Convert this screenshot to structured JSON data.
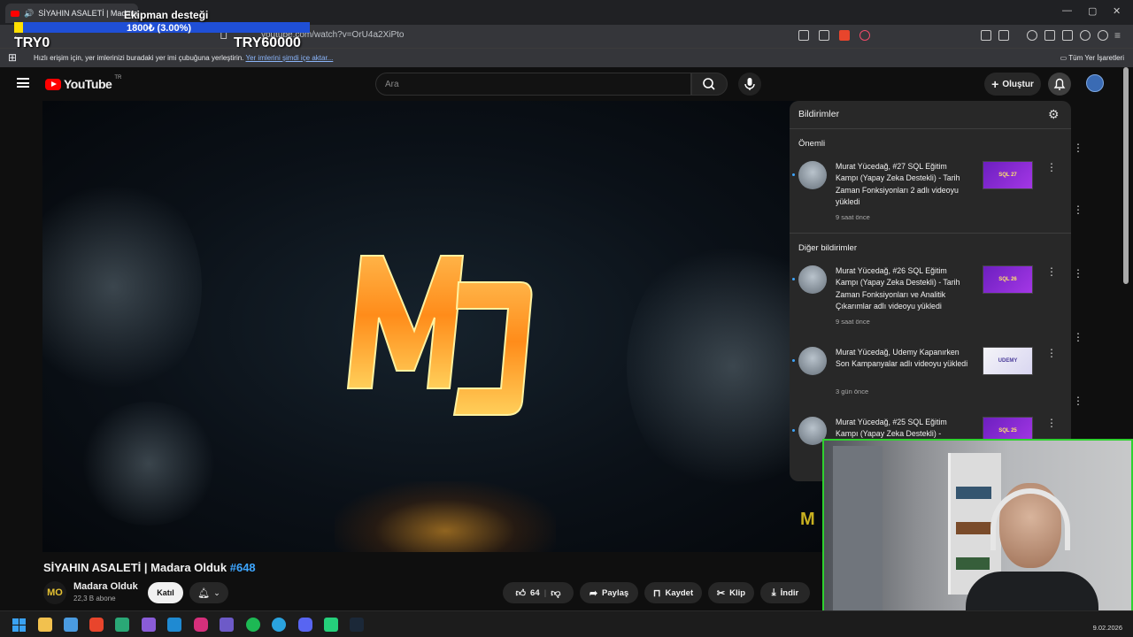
{
  "browser": {
    "tab_title": "SİYAHIN ASALETİ | Madara O",
    "url": "youtube.com/watch?v=OrU4a2XiPto",
    "bookmarks_hint": "Hızlı erişim için, yer imlerinizi buradaki yer imi çubuğuna yerleştirin.",
    "bookmarks_link": "Yer imlerini şimdi içe aktar...",
    "all_bookmarks": "Tüm Yer İşaretleri"
  },
  "overlay": {
    "title": "Ekipman desteği",
    "amount": "1800₺ (3.00%)",
    "progress": 0.03,
    "left_label": "TRY0",
    "right_label": "TRY60000"
  },
  "youtube": {
    "logo_text": "YouTube",
    "region": "TR",
    "search_placeholder": "Ara",
    "create_label": "Oluştur"
  },
  "video": {
    "title": "SİYAHIN ASALETİ | Madara Olduk",
    "tag": "#648",
    "channel": "Madara Olduk",
    "channel_initials": "MO",
    "subscribers": "22,3 B abone",
    "join_label": "Katıl",
    "likes": "64",
    "share_label": "Paylaş",
    "save_label": "Kaydet",
    "clip_label": "Klip",
    "download_label": "İndir"
  },
  "notifications": {
    "title": "Bildirimler",
    "important_label": "Önemli",
    "other_label": "Diğer bildirimler",
    "items": [
      {
        "text": "Murat Yücedağ, #27 SQL Eğitim Kampı (Yapay Zeka Destekli) - Tarih Zaman Fonksiyonları 2 adlı videoyu yükledi",
        "time": "9 saat önce",
        "thumb": "SQL 27"
      },
      {
        "text": "Murat Yücedağ, #26 SQL Eğitim Kampı (Yapay Zeka Destekli) - Tarih Zaman Fonksiyonları ve Analitik Çıkarımlar adlı videoyu yükledi",
        "time": "9 saat önce",
        "thumb": "SQL 26"
      },
      {
        "text": "Murat Yücedağ, Udemy Kapanırken Son Kampanyalar adlı videoyu yükledi",
        "time": "3 gün önce",
        "thumb": "UDEMY"
      },
      {
        "text": "Murat Yücedağ, #25 SQL Eğitim Kampı (Yapay Zeka Destekli) -",
        "time": "",
        "thumb": "SQL 25"
      }
    ]
  },
  "taskbar": {
    "date": "9.02.2026"
  },
  "colors": {
    "accent": "#3ea6ff",
    "youtube_red": "#ff0000",
    "webcam_border": "#2fd12f",
    "overlay_bar": "#1f4fd6",
    "overlay_fill": "#ffe000"
  }
}
